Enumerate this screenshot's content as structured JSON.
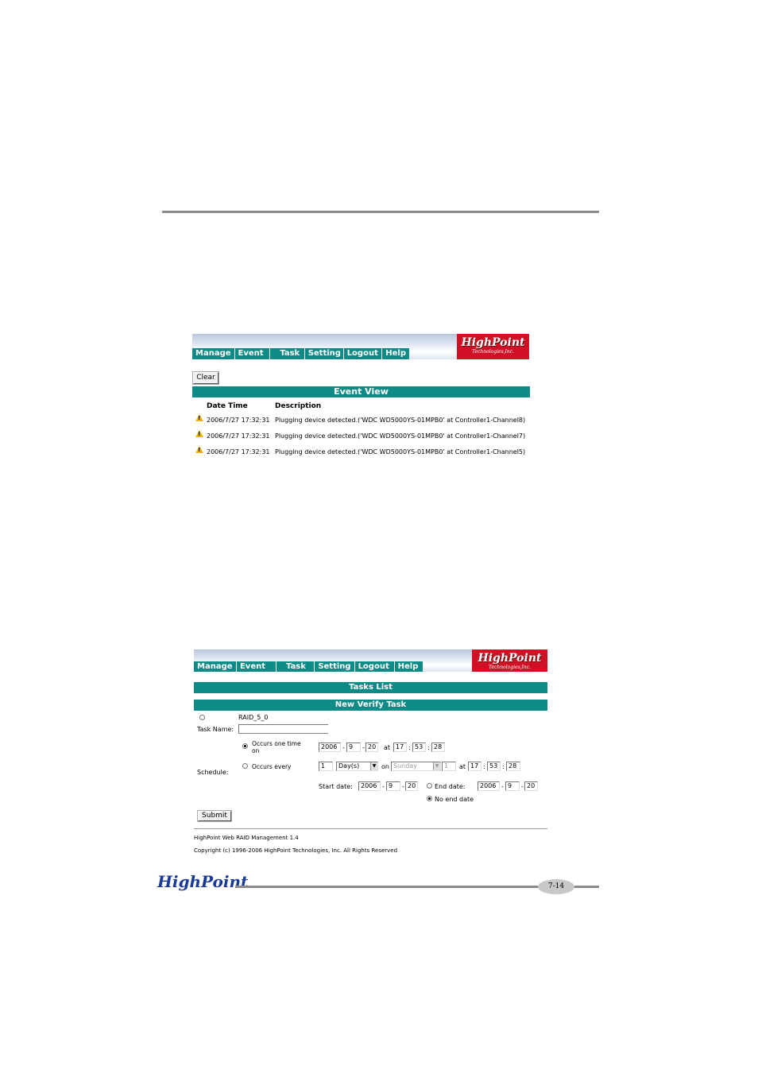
{
  "screen1": {
    "nav": [
      "Manage",
      "Event",
      "Task",
      "Setting",
      "Logout",
      "Help"
    ],
    "logo": {
      "brand": "HighPoint",
      "sub": "Technologies,Inc."
    },
    "clear_button": "Clear",
    "section_title": "Event View",
    "columns": [
      "Date Time",
      "Description"
    ],
    "events": [
      {
        "time": "2006/7/27 17:32:31",
        "description": "Plugging device detected.('WDC WD5000YS-01MPB0' at Controller1-Channel8)"
      },
      {
        "time": "2006/7/27 17:32:31",
        "description": "Plugging device detected.('WDC WD5000YS-01MPB0' at Controller1-Channel7)"
      },
      {
        "time": "2006/7/27 17:32:31",
        "description": "Plugging device detected.('WDC WD5000YS-01MPB0' at Controller1-Channel5)"
      }
    ]
  },
  "screen2": {
    "nav": [
      "Manage",
      "Event",
      "Task",
      "Setting",
      "Logout",
      "Help"
    ],
    "logo": {
      "brand": "HighPoint",
      "sub": "Technologies,Inc."
    },
    "tasks_list_title": "Tasks List",
    "new_task_title": "New Verify Task",
    "array_name": "RAID_5_0",
    "task_name_label": "Task Name:",
    "task_name_value": "",
    "schedule_label": "Schedule:",
    "occurs_once_label_1": "Occurs one time",
    "occurs_once_label_2": "on",
    "once": {
      "year": "2006",
      "month": "9",
      "day": "20",
      "at": "at",
      "hour": "17",
      "minute": "53",
      "second": "28"
    },
    "occurs_every_label": "Occurs every",
    "every": {
      "count": "1",
      "unit": "Day(s)",
      "on": "on",
      "weekday": "Sunday",
      "weekday_num": "1",
      "at": "at",
      "hour": "17",
      "minute": "53",
      "second": "28"
    },
    "start_date_label": "Start date:",
    "start": {
      "year": "2006",
      "month": "9",
      "day": "20"
    },
    "end_date_label": "End date:",
    "end": {
      "year": "2006",
      "month": "9",
      "day": "20"
    },
    "no_end_label": "No end date",
    "submit_button": "Submit",
    "footer_line1": "HighPoint Web RAID Management 1.4",
    "footer_line2": "Copyright (c) 1996-2006 HighPoint Technologies, Inc. All Rights Reserved"
  },
  "page_footer": {
    "brand": "HighPoint",
    "page_number": "7-14"
  }
}
